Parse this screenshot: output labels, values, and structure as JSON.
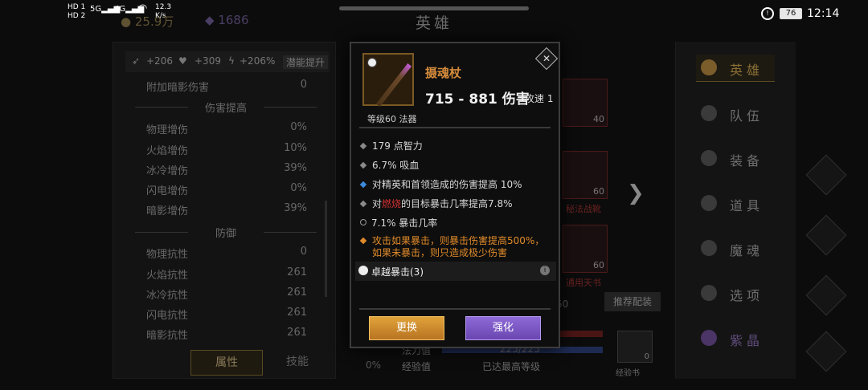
{
  "status": {
    "sim1": "HD 1",
    "sim2": "HD 2",
    "net1": "5G",
    "net2": "4G",
    "speed_value": "12.3",
    "speed_unit": "K/s",
    "battery": "76",
    "time": "12:14"
  },
  "top": {
    "gold": "25.9万",
    "gems": "1686",
    "title": "英雄"
  },
  "left": {
    "bonuses": [
      "+206",
      "+309",
      "+206%"
    ],
    "potential_button": "潜能提升",
    "stats_top": [
      {
        "label": "附加暗影伤害",
        "value": "0"
      }
    ],
    "section_damage": "伤害提高",
    "damage": [
      {
        "label": "物理增伤",
        "value": "0%"
      },
      {
        "label": "火焰增伤",
        "value": "10%"
      },
      {
        "label": "冰冷增伤",
        "value": "39%"
      },
      {
        "label": "闪电增伤",
        "value": "0%"
      },
      {
        "label": "暗影增伤",
        "value": "39%"
      }
    ],
    "section_defense": "防御",
    "defense": [
      {
        "label": "物理抗性",
        "value": "0"
      },
      {
        "label": "火焰抗性",
        "value": "261"
      },
      {
        "label": "冰冷抗性",
        "value": "261"
      },
      {
        "label": "闪电抗性",
        "value": "261"
      },
      {
        "label": "暗影抗性",
        "value": "261"
      }
    ],
    "tab_attr": "属性",
    "tab_skill": "技能"
  },
  "center": {
    "slot_levels": [
      "40",
      "60",
      "60"
    ],
    "slot_labels": [
      "秘法战靴",
      "通用天书"
    ],
    "recommend": "推荐配装",
    "hp_val": "50",
    "mp_label": "法力值",
    "mp_value": "225/225",
    "exp_label": "经验值",
    "exp_value": "已达最高等级",
    "pct": "0%",
    "expbook": "经验书",
    "expbook_count": "0"
  },
  "nav": [
    "英雄",
    "队伍",
    "装备",
    "道具",
    "魔魂",
    "选项",
    "紫晶"
  ],
  "popup": {
    "name": "摄魂杖",
    "damage": "715 - 881 伤害",
    "speed": "攻速 1",
    "level": "等级60 法器",
    "close": "✕",
    "affixes": [
      {
        "text": "179 点智力"
      },
      {
        "text": "6.7% 吸血"
      },
      {
        "text": "对精英和首领造成的伤害提高 10%"
      }
    ],
    "burn_prefix": "对",
    "burn_word": "燃烧",
    "burn_suffix": "的目标暴击几率提高7.8%",
    "crit": "7.1% 暴击几率",
    "special": "攻击如果暴击，则暴击伤害提高500%，如果未暴击，则只造成极少伤害",
    "set": "卓越暴击(3)",
    "info": "i",
    "btn_replace": "更换",
    "btn_enhance": "强化"
  },
  "colors": {
    "accent_gold": "#d58b3c",
    "burn_red": "#d23030",
    "special_orange": "#e08a2a",
    "enhance_purple": "#7a56c4"
  }
}
